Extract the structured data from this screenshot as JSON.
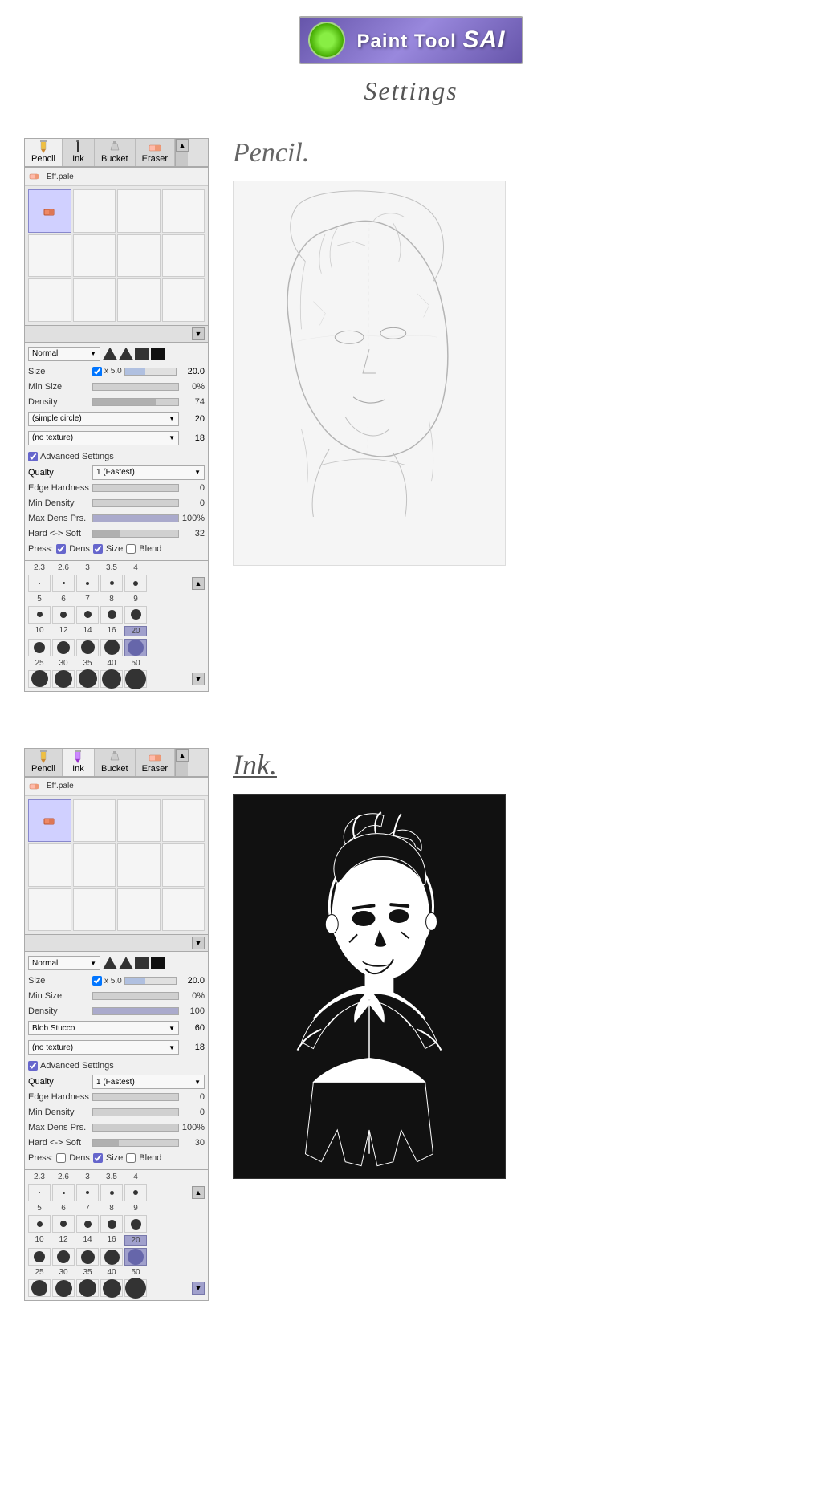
{
  "header": {
    "logo_text": "Paint Tool",
    "logo_sai": "SAI",
    "settings_title": "Settings"
  },
  "pencil_panel": {
    "tabs": [
      {
        "label": "Pencil",
        "active": true
      },
      {
        "label": "Ink",
        "active": false
      },
      {
        "label": "Bucket",
        "active": false
      },
      {
        "label": "Eraser",
        "active": false
      }
    ],
    "eff_pale": "Eff.pale",
    "normal_label": "Normal",
    "size_label": "Size",
    "size_multiplier": "x 5.0",
    "size_value": "20.0",
    "min_size_label": "Min Size",
    "min_size_value": "0%",
    "density_label": "Density",
    "density_value": "74",
    "density_pct": 74,
    "shape_label": "(simple circle)",
    "shape_value": "20",
    "texture_label": "(no texture)",
    "texture_value": "18",
    "advanced_label": "Advanced Settings",
    "qualty_label": "Qualty",
    "qualty_value": "1 (Fastest)",
    "edge_hardness_label": "Edge Hardness",
    "edge_hardness_value": "0",
    "min_density_label": "Min Density",
    "min_density_value": "0",
    "max_dens_prs_label": "Max Dens Prs.",
    "max_dens_prs_value": "100%",
    "hard_soft_label": "Hard <-> Soft",
    "hard_soft_value": "32",
    "press_label": "Press:",
    "press_dens": "Dens",
    "press_size": "Size",
    "press_blend": "Blend",
    "brush_sizes_row1": [
      "2.3",
      "2.6",
      "3",
      "3.5",
      "4"
    ],
    "brush_sizes_row2": [
      "5",
      "6",
      "7",
      "8",
      "9"
    ],
    "brush_sizes_row3": [
      "10",
      "12",
      "14",
      "16",
      "20"
    ],
    "brush_sizes_row4": [
      "25",
      "30",
      "35",
      "40",
      "50"
    ],
    "selected_size": "20"
  },
  "ink_panel": {
    "tabs": [
      {
        "label": "Pencil",
        "active": false
      },
      {
        "label": "Ink",
        "active": true
      },
      {
        "label": "Bucket",
        "active": false
      },
      {
        "label": "Eraser",
        "active": false
      }
    ],
    "eff_pale": "Eff.pale",
    "normal_label": "Normal",
    "size_label": "Size",
    "size_multiplier": "x 5.0",
    "size_value": "20.0",
    "min_size_label": "Min Size",
    "min_size_value": "0%",
    "density_label": "Density",
    "density_value": "100",
    "density_pct": 100,
    "shape_label": "Blob Stucco",
    "shape_value": "60",
    "texture_label": "(no texture)",
    "texture_value": "18",
    "advanced_label": "Advanced Settings",
    "qualty_label": "Qualty",
    "qualty_value": "1 (Fastest)",
    "edge_hardness_label": "Edge Hardness",
    "edge_hardness_value": "0",
    "min_density_label": "Min Density",
    "min_density_value": "0",
    "max_dens_prs_label": "Max Dens Prs.",
    "max_dens_prs_value": "100%",
    "hard_soft_label": "Hard <-> Soft",
    "hard_soft_value": "30",
    "press_label": "Press:",
    "press_dens": "Dens",
    "press_size": "Size",
    "press_blend": "Blend",
    "brush_sizes_row1": [
      "2.3",
      "2.6",
      "3",
      "3.5",
      "4"
    ],
    "brush_sizes_row2": [
      "5",
      "6",
      "7",
      "8",
      "9"
    ],
    "brush_sizes_row3": [
      "10",
      "12",
      "14",
      "16",
      "20"
    ],
    "brush_sizes_row4": [
      "25",
      "30",
      "35",
      "40",
      "50"
    ],
    "selected_size": "20"
  },
  "sections": {
    "pencil_title": "Pencil.",
    "ink_title": "Ink."
  }
}
